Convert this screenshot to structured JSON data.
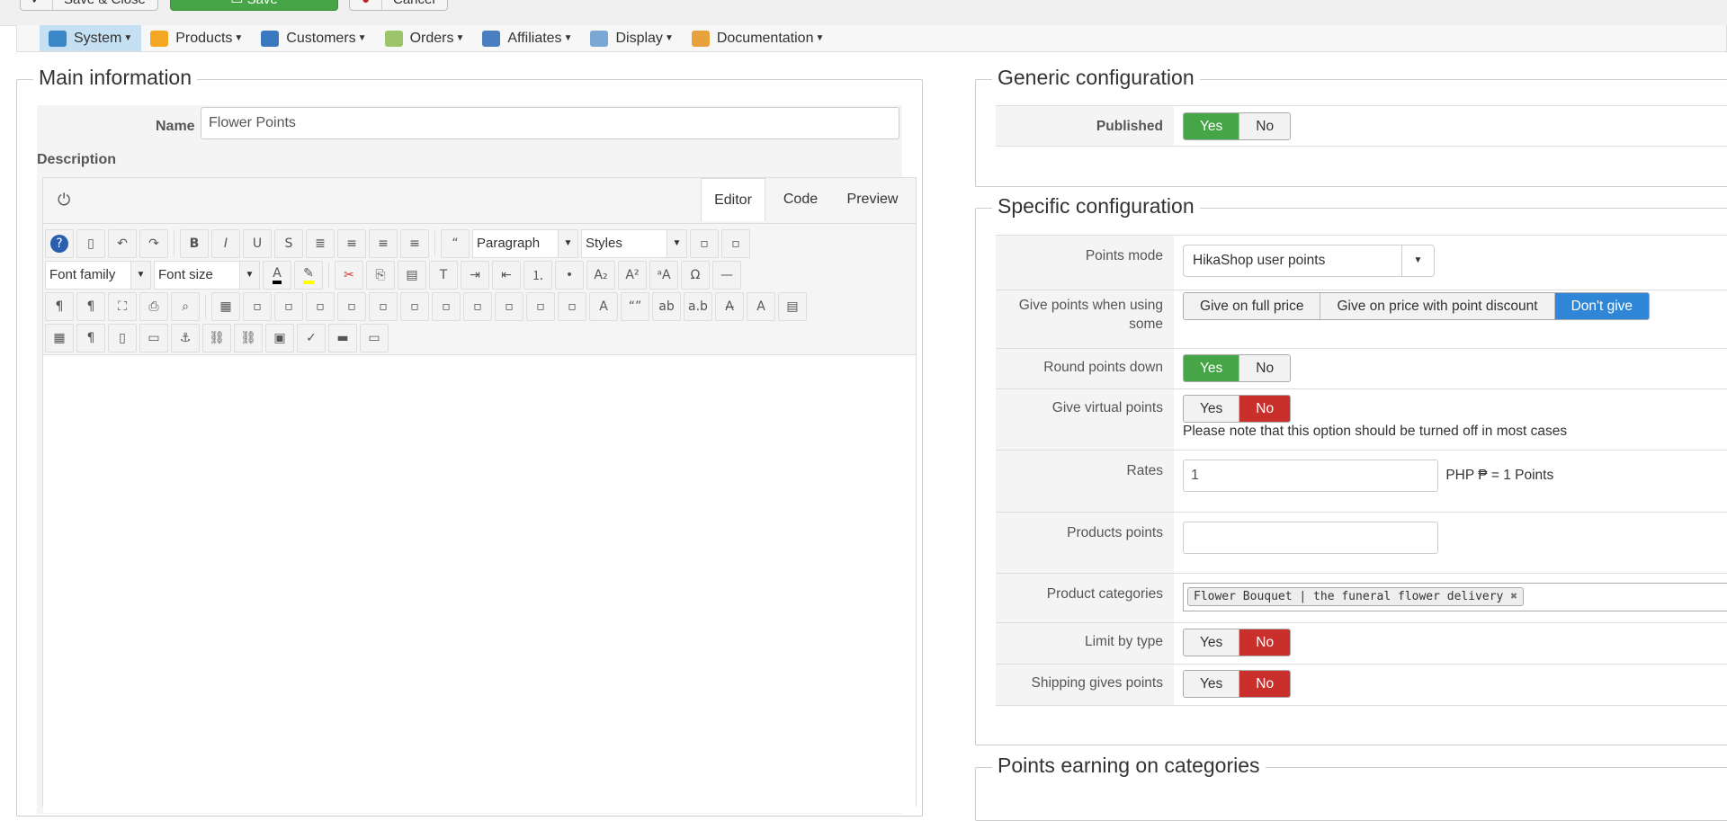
{
  "toolbar": {
    "save_close": "Save & Close",
    "save": "Save",
    "cancel": "Cancel"
  },
  "nav": [
    {
      "label": "System",
      "color": "#3b87c8"
    },
    {
      "label": "Products",
      "color": "#f5a623"
    },
    {
      "label": "Customers",
      "color": "#3a78c0"
    },
    {
      "label": "Orders",
      "color": "#9bc46b"
    },
    {
      "label": "Affiliates",
      "color": "#4a7fbf"
    },
    {
      "label": "Display",
      "color": "#7ba7d4"
    },
    {
      "label": "Documentation",
      "color": "#e8a23c"
    }
  ],
  "main": {
    "legend": "Main information",
    "name_label": "Name",
    "name_value": "Flower Points",
    "description_label": "Description",
    "tabs": [
      "Editor",
      "Code",
      "Preview"
    ],
    "format_select": "Paragraph",
    "styles_select": "Styles",
    "font_family": "Font family",
    "font_size": "Font size"
  },
  "editor_icons": {
    "row1": [
      "help",
      "new-document",
      "undo",
      "redo",
      "|",
      "bold",
      "italic",
      "underline",
      "strikethrough",
      "justify",
      "align-center",
      "align-left",
      "align-right",
      "|",
      "blockquote"
    ],
    "row2b": [
      "|",
      "cut",
      "copy",
      "paste",
      "paste-text",
      "indent",
      "outdent",
      "numbered-list",
      "bullet-list",
      "subscript",
      "superscript",
      "case",
      "special-char",
      "horizontal-rule"
    ],
    "row3": [
      "ltr",
      "rtl",
      "fullscreen",
      "print",
      "find",
      "|",
      "table",
      "delete-table",
      "row-props",
      "cell-props",
      "insert-row-before",
      "insert-row-after",
      "delete-row",
      "insert-col-before",
      "insert-col-after",
      "delete-col",
      "split-cells",
      "merge-cells",
      "style-props",
      "quote",
      "abbr",
      "acronym",
      "del",
      "ins",
      "attributes"
    ],
    "row4": [
      "visual-aid",
      "show-blocks",
      "template",
      "pagebreak",
      "anchor",
      "unlink",
      "link",
      "image",
      "spellcheck",
      "readmore",
      "article"
    ]
  },
  "generic": {
    "legend": "Generic configuration",
    "published_label": "Published",
    "yes": "Yes",
    "no": "No"
  },
  "specific": {
    "legend": "Specific configuration",
    "points_mode_label": "Points mode",
    "points_mode_value": "HikaShop user points",
    "give_label": "Give points when using some",
    "give_options": [
      "Give on full price",
      "Give on price with point discount",
      "Don't give"
    ],
    "round_label": "Round points down",
    "virtual_label": "Give virtual points",
    "virtual_note": "Please note that this option should be turned off in most cases",
    "rates_label": "Rates",
    "rates_value": "1",
    "rates_suffix": "PHP ₱ = 1 Points",
    "products_points_label": "Products points",
    "products_points_value": "",
    "categories_label": "Product categories",
    "category_tag": "Flower Bouquet | the funeral flower delivery",
    "limit_label": "Limit by type",
    "shipping_label": "Shipping gives points",
    "yes": "Yes",
    "no": "No"
  },
  "earning": {
    "legend": "Points earning on categories"
  },
  "colors": {
    "green": "#46a546",
    "red": "#c9302c",
    "blue": "#2f86d6"
  }
}
